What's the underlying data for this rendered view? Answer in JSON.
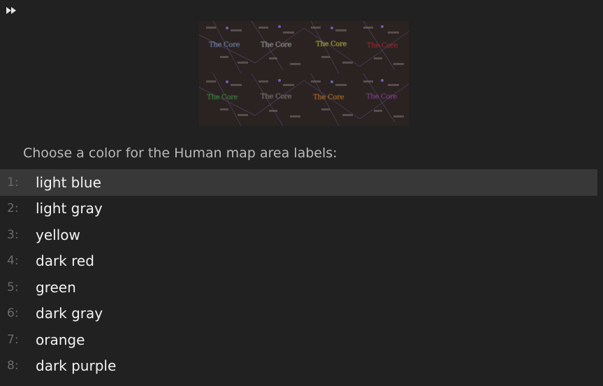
{
  "skip_button": {
    "icon": "fast-forward-icon"
  },
  "preview": {
    "labels": [
      {
        "text": "The Core",
        "color": "#8fa8e8"
      },
      {
        "text": "The Core",
        "color": "#c8c8c8"
      },
      {
        "text": "The Core",
        "color": "#e6e04a"
      },
      {
        "text": "The Core",
        "color": "#c8283a"
      },
      {
        "text": "The Core",
        "color": "#3fae4a"
      },
      {
        "text": "The Core",
        "color": "#9a9a9a"
      },
      {
        "text": "The Core",
        "color": "#e88a2a"
      },
      {
        "text": "The Core",
        "color": "#a84ab8"
      }
    ]
  },
  "prompt": "Choose a color for the Human map area labels:",
  "options": [
    {
      "number": "1:",
      "label": "light blue",
      "selected": true
    },
    {
      "number": "2:",
      "label": "light gray",
      "selected": false
    },
    {
      "number": "3:",
      "label": "yellow",
      "selected": false
    },
    {
      "number": "4:",
      "label": "dark red",
      "selected": false
    },
    {
      "number": "5:",
      "label": "green",
      "selected": false
    },
    {
      "number": "6:",
      "label": "dark gray",
      "selected": false
    },
    {
      "number": "7:",
      "label": "orange",
      "selected": false
    },
    {
      "number": "8:",
      "label": "dark purple",
      "selected": false
    }
  ]
}
